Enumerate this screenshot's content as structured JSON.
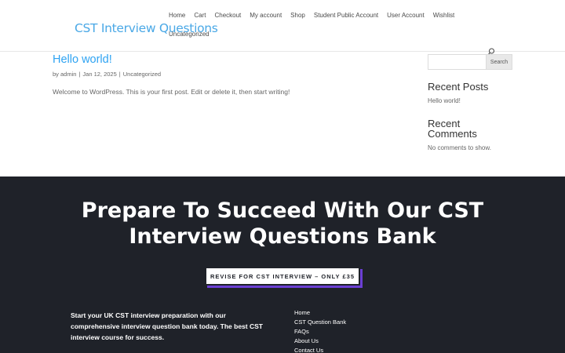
{
  "header": {
    "logo_text": "CST Interview Questions",
    "nav": [
      "Home",
      "Cart",
      "Checkout",
      "My account",
      "Shop",
      "Student Public Account",
      "User Account",
      "Wishlist"
    ],
    "nav_row2": "Uncategorized"
  },
  "post": {
    "title": "Hello world!",
    "author": "admin",
    "date": "Jan 12, 2025",
    "category": "Uncategorized",
    "body": "Welcome to WordPress. This is your first post. Edit or delete it, then start writing!"
  },
  "sidebar": {
    "search_placeholder": "",
    "search_button": "Search",
    "recent_posts_title": "Recent Posts",
    "recent_posts": [
      "Hello world!"
    ],
    "recent_comments_title_line1": "Recent",
    "recent_comments_title_line2": "Comments",
    "recent_comments_empty": "No comments to show."
  },
  "hero": {
    "title_line1": "Prepare To Succeed With Our CST",
    "title_line2": "Interview Questions Bank",
    "cta": "REVISE FOR CST INTERVIEW – ONLY £35"
  },
  "footer": {
    "text": "Start your UK CST interview preparation with our comprehensive interview question bank today. The best CST interview course for success.",
    "links": [
      "Home",
      "CST Question Bank",
      "FAQs",
      "About Us",
      "Contact Us"
    ]
  },
  "colors": {
    "accent": "#2ea3f2",
    "logo": "#4aa8e6",
    "dark_bg": "#1f2229",
    "cta_shadow": "#6b3fd4"
  }
}
